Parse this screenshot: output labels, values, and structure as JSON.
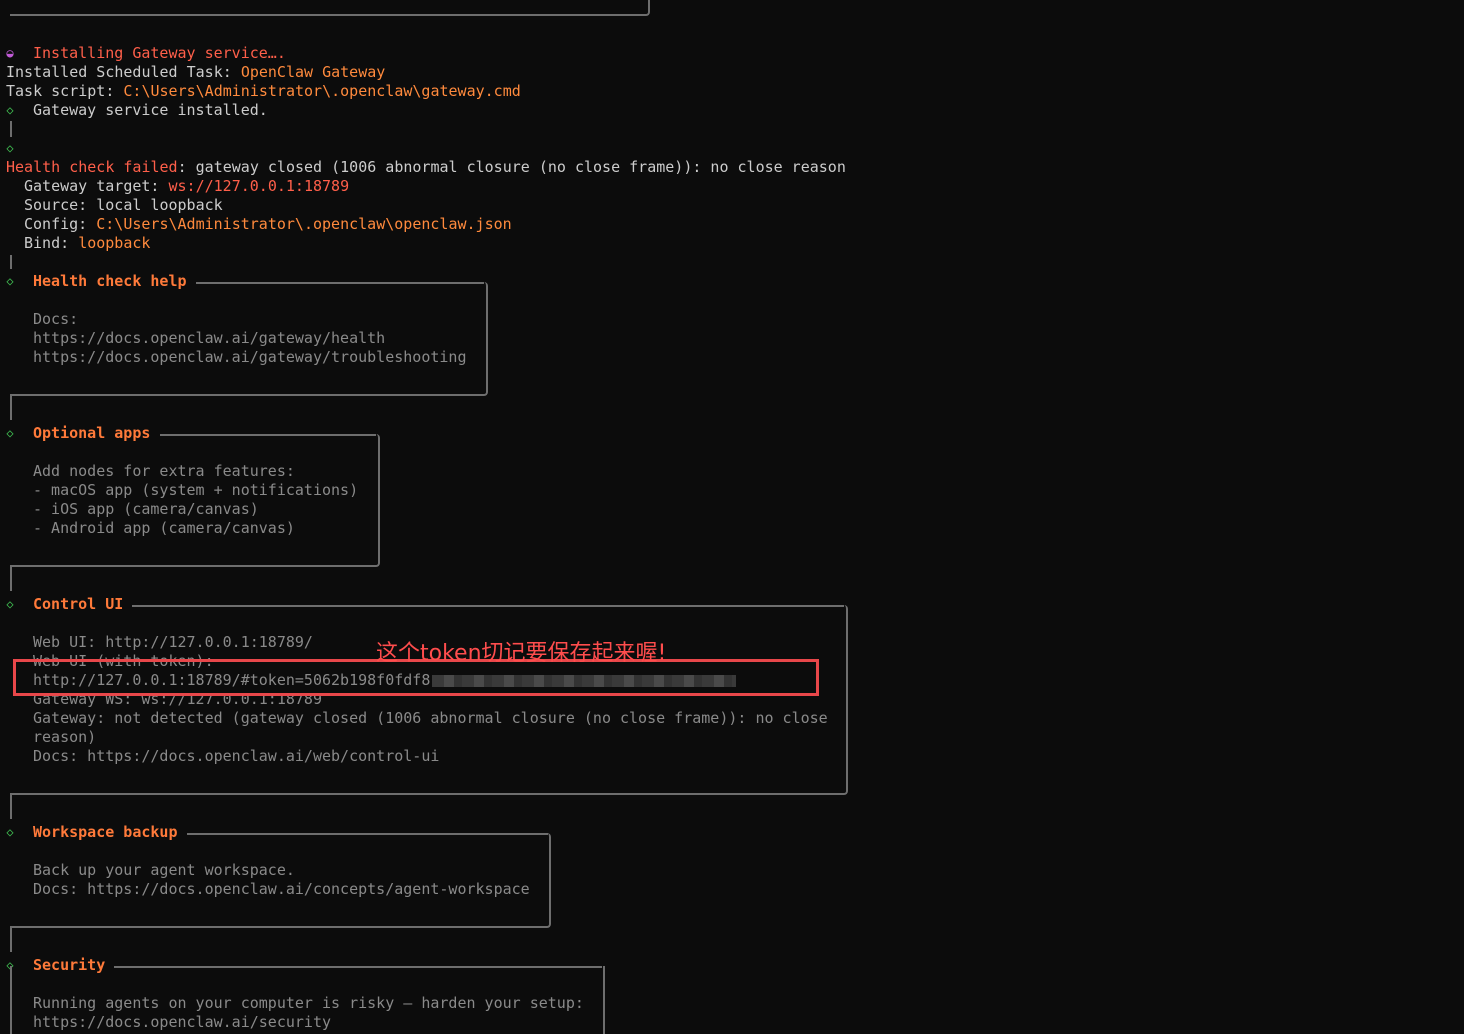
{
  "lines": {
    "installing": "Installing Gateway service….",
    "scheduled_label": "Installed Scheduled Task: ",
    "scheduled_value": "OpenClaw Gateway",
    "script_label": "Task script: ",
    "script_value": "C:\\Users\\Administrator\\.openclaw\\gateway.cmd",
    "installed": "Gateway service installed.",
    "health_failed_label": "Health check failed",
    "health_failed_msg": ": gateway closed (1006 abnormal closure (no close frame)): no close reason",
    "target_label": "Gateway target: ",
    "target_value": "ws://127.0.0.1:18789",
    "source_line": "Source: local loopback",
    "config_label": "Config: ",
    "config_value": "C:\\Users\\Administrator\\.openclaw\\openclaw.json",
    "bind_label": "Bind: ",
    "bind_value": "loopback"
  },
  "sections": {
    "health_help": {
      "title": "Health check help",
      "lines": [
        "Docs:",
        "https://docs.openclaw.ai/gateway/health",
        "https://docs.openclaw.ai/gateway/troubleshooting"
      ]
    },
    "optional_apps": {
      "title": "Optional apps",
      "lines": [
        "Add nodes for extra features:",
        "- macOS app (system + notifications)",
        "- iOS app (camera/canvas)",
        "- Android app (camera/canvas)"
      ]
    },
    "control_ui": {
      "title": "Control UI",
      "web_ui": "Web UI: http://127.0.0.1:18789/",
      "web_ui_token_label": "Web UI (with token):",
      "token_url": "http://127.0.0.1:18789/#token=5062b198f0fdf8",
      "gateway_ws": "Gateway WS: ws://127.0.0.1:18789",
      "gateway_status_1": "Gateway: not detected (gateway closed (1006 abnormal closure (no close frame)): no close",
      "gateway_status_2": "reason)",
      "docs": "Docs: https://docs.openclaw.ai/web/control-ui"
    },
    "workspace_backup": {
      "title": "Workspace backup",
      "lines": [
        "Back up your agent workspace.",
        "Docs: https://docs.openclaw.ai/concepts/agent-workspace"
      ]
    },
    "security": {
      "title": "Security",
      "lines": [
        "Running agents on your computer is risky — harden your setup:",
        "https://docs.openclaw.ai/security"
      ]
    }
  },
  "annotation": {
    "text": "这个token切记要保存起来喔!",
    "color": "#ff4d4d"
  },
  "icons": {
    "step_done": "diamond-outline-icon",
    "step_running": "spinner-dot-icon"
  },
  "colors": {
    "background": "#0c0c0c",
    "accent_orange": "#ff8a3d",
    "error_red": "#ff5f4a",
    "ok_green": "#3fb950",
    "running_purple": "#c05ad6"
  }
}
